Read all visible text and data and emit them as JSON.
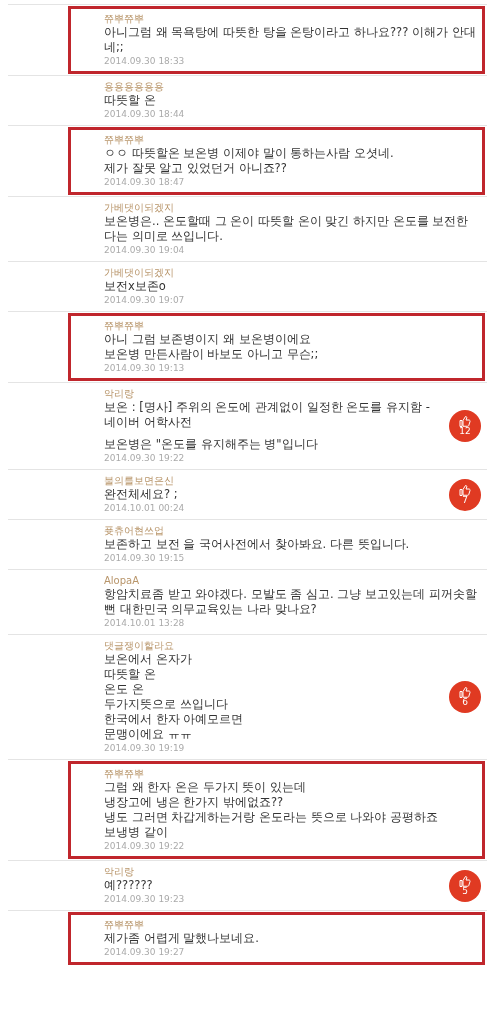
{
  "comments": [
    {
      "author": "쮸뿌쮸뿌",
      "paragraphs": [
        [
          "아니그럼 왜 목욕탕에 따뜻한 탕을 온탕이라고 하나요??? 이해가 안대",
          "네;;"
        ]
      ],
      "time": "2014.09.30 18:33",
      "highlighted": true
    },
    {
      "author": "용용용용용용",
      "paragraphs": [
        [
          "따뜻할 온"
        ]
      ],
      "time": "2014.09.30 18:44",
      "highlighted": false
    },
    {
      "author": "쮸뿌쮸뿌",
      "paragraphs": [
        [
          "ㅇㅇ 따뜻할온 보온병 이제야 말이 통하는사람 오셧네.",
          "제가 잘못 알고 있었던거 아니죠??"
        ]
      ],
      "time": "2014.09.30 18:47",
      "highlighted": true
    },
    {
      "author": "가베댓이되겠지",
      "paragraphs": [
        [
          "보온병은.. 온도할때 그 온이 따뜻할 온이 맞긴 하지만 온도를 보전한",
          "다는 의미로 쓰입니다."
        ]
      ],
      "time": "2014.09.30 19:04",
      "highlighted": false
    },
    {
      "author": "가베댓이되겠지",
      "paragraphs": [
        [
          "보전x보존o"
        ]
      ],
      "time": "2014.09.30 19:07",
      "highlighted": false
    },
    {
      "author": "쮸뿌쮸뿌",
      "paragraphs": [
        [
          "아니 그럼 보존병이지 왜 보온병이에요",
          "보온병 만든사람이 바보도 아니고 무슨;;"
        ]
      ],
      "time": "2014.09.30 19:13",
      "highlighted": true
    },
    {
      "author": "악리랑",
      "paragraphs": [
        [
          "보온 : [명사] 주위의 온도에 관계없이 일정한 온도를 유지함 -",
          " 네이버 어학사전"
        ],
        [
          "보온병은 \"온도를 유지해주는 병\"입니다"
        ]
      ],
      "time": "2014.09.30 19:22",
      "highlighted": false,
      "likes": "12"
    },
    {
      "author": "불의를보면은신",
      "paragraphs": [
        [
          "완전체세요? ;"
        ]
      ],
      "time": "2014.10.01 00:24",
      "highlighted": false,
      "likes": "7"
    },
    {
      "author": "퓻츄어현쓰업",
      "paragraphs": [
        [
          "보존하고 보전 을 국어사전에서 찾아봐요. 다른 뜻입니다."
        ]
      ],
      "time": "2014.09.30 19:15",
      "highlighted": false
    },
    {
      "author": "AlopaA",
      "paragraphs": [
        [
          "항암치료좀 받고 와야겠다. 모발도 좀 심고. 그냥 보고있는데 피꺼솟할",
          "뻔 대한민국 의무교육있는 나라 맞나요?"
        ]
      ],
      "time": "2014.10.01 13:28",
      "highlighted": false
    },
    {
      "author": "댓글쟁이할라요",
      "paragraphs": [
        [
          "보온에서 온자가",
          "따뜻할 온",
          "온도 온",
          "두가지뜻으로 쓰입니다",
          "한국에서 한자 아예모르면",
          "문맹이에요 ㅠㅠ"
        ]
      ],
      "time": "2014.09.30 19:19",
      "highlighted": false,
      "likes": "6"
    },
    {
      "author": "쮸뿌쮸뿌",
      "paragraphs": [
        [
          "그럼 왜 한자 온은 두가지 뜻이 있는데",
          "냉장고에 냉은 한가지 밖에없죠??",
          "냉도 그러면 차갑게하는거랑 온도라는 뜻으로 나와야 공평하죠",
          "보냉병 같이"
        ]
      ],
      "time": "2014.09.30 19:22",
      "highlighted": true
    },
    {
      "author": "악리랑",
      "paragraphs": [
        [
          "예??????"
        ]
      ],
      "time": "2014.09.30 19:23",
      "highlighted": false,
      "likes": "5"
    },
    {
      "author": "쮸뿌쮸뿌",
      "paragraphs": [
        [
          "제가좀 어렵게 말했나보네요."
        ]
      ],
      "time": "2014.09.30 19:27",
      "highlighted": true
    }
  ]
}
